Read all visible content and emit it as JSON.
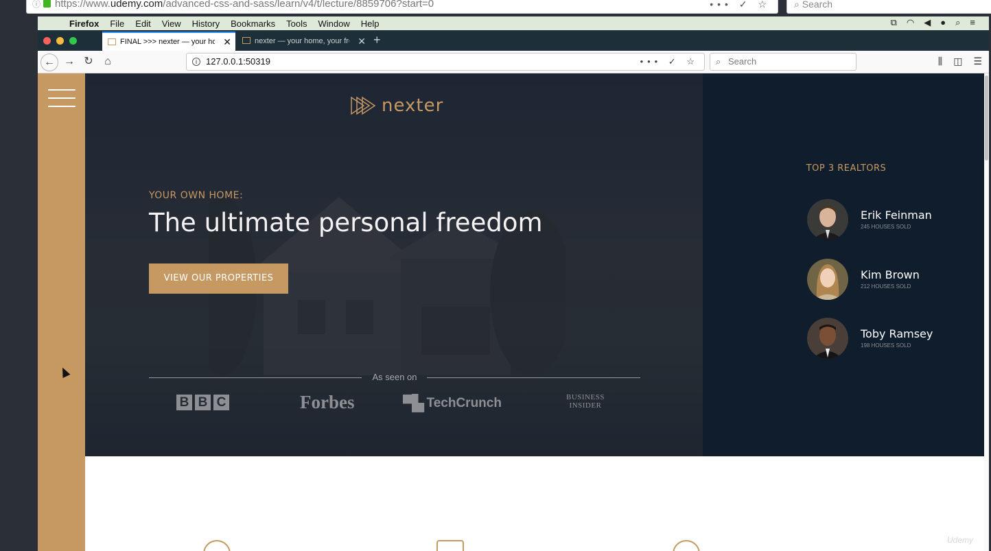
{
  "outer_browser": {
    "url_prefix": "https://www.",
    "url_domain": "udemy.com",
    "url_path": "/advanced-css-and-sass/learn/v4/t/lecture/8859706?start=0",
    "search_placeholder": "Search"
  },
  "menubar": {
    "app": "Firefox",
    "items": [
      "File",
      "Edit",
      "View",
      "History",
      "Bookmarks",
      "Tools",
      "Window",
      "Help"
    ]
  },
  "tabs": [
    {
      "label": "FINAL >>> nexter — your home",
      "active": true
    },
    {
      "label": "nexter — your home, your freed",
      "active": false
    }
  ],
  "navbar": {
    "url": "127.0.0.1:50319",
    "search_placeholder": "Search"
  },
  "page": {
    "logo_text": "nexter",
    "subtitle": "YOUR OWN HOME:",
    "heading": "The ultimate personal freedom",
    "cta_label": "VIEW OUR PROPERTIES",
    "seen_on": "As seen on",
    "brands": {
      "bbc": [
        "B",
        "B",
        "C"
      ],
      "forbes": "Forbes",
      "techcrunch": "TechCrunch",
      "business_insider_1": "BUSINESS",
      "business_insider_2": "INSIDER"
    },
    "realtors_title": "TOP 3 REALTORS",
    "realtors": [
      {
        "name": "Erik Feinman",
        "sold": "245 HOUSES SOLD"
      },
      {
        "name": "Kim Brown",
        "sold": "212 HOUSES SOLD"
      },
      {
        "name": "Toby Ramsey",
        "sold": "198 HOUSES SOLD"
      }
    ]
  },
  "colors": {
    "primary": "#c69963",
    "dark": "#101d2c",
    "header_bg": "#272d34"
  },
  "watermark": "Udemy"
}
